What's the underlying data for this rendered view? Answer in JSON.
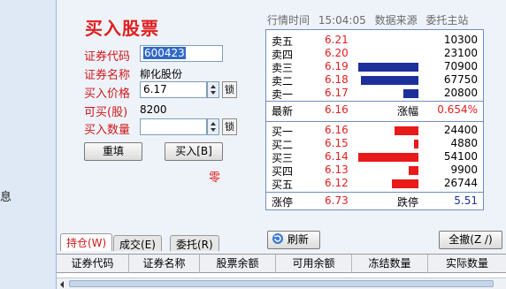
{
  "left": {
    "label": "息"
  },
  "title": "买入股票",
  "form": {
    "code_label": "证券代码",
    "code_value": "600423",
    "name_label": "证券名称",
    "name_value": "柳化股份",
    "price_label": "买入价格",
    "price_value": "6.17",
    "lock": "锁",
    "avail_label": "可买(股)",
    "avail_value": "8200",
    "qty_label": "买入数量",
    "qty_value": "",
    "reset_button": "重填",
    "buy_button": "买入[B]",
    "zero_text": "零"
  },
  "quote_header": {
    "time_label": "行情时间",
    "time_value": "15:04:05",
    "source_label": "数据来源",
    "source_value": "委托主站"
  },
  "sell": [
    {
      "name": "卖五",
      "price": "6.21",
      "volume": "10300",
      "bar_pct": 0
    },
    {
      "name": "卖四",
      "price": "6.20",
      "volume": "23100",
      "bar_pct": 0
    },
    {
      "name": "卖三",
      "price": "6.19",
      "volume": "70900",
      "bar_pct": 100
    },
    {
      "name": "卖二",
      "price": "6.18",
      "volume": "67750",
      "bar_pct": 96
    },
    {
      "name": "卖一",
      "price": "6.17",
      "volume": "20800",
      "bar_pct": 25
    }
  ],
  "mid": {
    "latest_label": "最新",
    "latest_value": "6.16",
    "change_label": "涨幅",
    "change_value": "0.654%"
  },
  "buy": [
    {
      "name": "买一",
      "price": "6.16",
      "volume": "24400",
      "bar_pct": 40
    },
    {
      "name": "买二",
      "price": "6.15",
      "volume": "4880",
      "bar_pct": 8
    },
    {
      "name": "买三",
      "price": "6.14",
      "volume": "54100",
      "bar_pct": 100
    },
    {
      "name": "买四",
      "price": "6.13",
      "volume": "9900",
      "bar_pct": 16
    },
    {
      "name": "买五",
      "price": "6.12",
      "volume": "26744",
      "bar_pct": 44
    }
  ],
  "limits": {
    "up_label": "涨停",
    "up_value": "6.73",
    "down_label": "跌停",
    "down_value": "5.51"
  },
  "tabs": [
    {
      "label": "持仓(W)"
    },
    {
      "label": "成交(E)"
    },
    {
      "label": "委托(R)"
    }
  ],
  "refresh_button": "刷新",
  "all_button": "全撤(Z /)",
  "table_columns": [
    "证券代码",
    "证券名称",
    "股票余额",
    "可用余额",
    "冻结数量",
    "实际数量"
  ],
  "colors": {
    "price_red": "#e02020",
    "sell_bar": "#1c2f9a",
    "buy_bar": "#e81a1a",
    "buy_green": "#0a8a1a"
  }
}
